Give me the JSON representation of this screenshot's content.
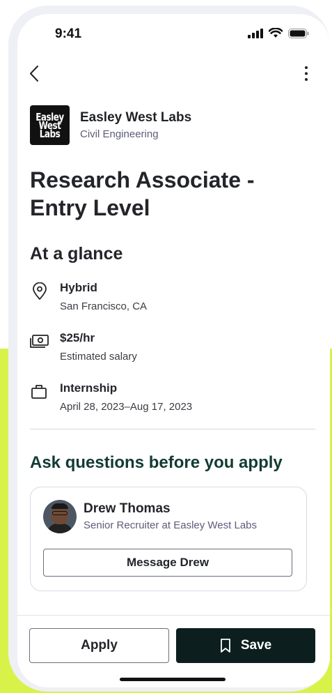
{
  "status_bar": {
    "time": "9:41"
  },
  "company": {
    "logo_lines": [
      "Easley",
      "West",
      "Labs"
    ],
    "name": "Easley West Labs",
    "industry": "Civil Engineering"
  },
  "job": {
    "title": "Research Associate - Entry Level"
  },
  "glance": {
    "title": "At a glance",
    "items": [
      {
        "icon": "location-pin-icon",
        "primary": "Hybrid",
        "secondary": "San Francisco, CA"
      },
      {
        "icon": "money-icon",
        "primary": "$25/hr",
        "secondary": "Estimated salary"
      },
      {
        "icon": "briefcase-icon",
        "primary": "Internship",
        "secondary": "April 28, 2023–Aug 17, 2023"
      }
    ]
  },
  "ask": {
    "title": "Ask questions before you apply",
    "recruiter_name": "Drew Thomas",
    "recruiter_role": "Senior Recruiter at Easley West Labs",
    "message_label": "Message Drew"
  },
  "actions": {
    "apply_label": "Apply",
    "save_label": "Save"
  },
  "colors": {
    "accent_dark": "#0c1f1e",
    "lime": "#d9f24a",
    "ask_title": "#123b34"
  }
}
